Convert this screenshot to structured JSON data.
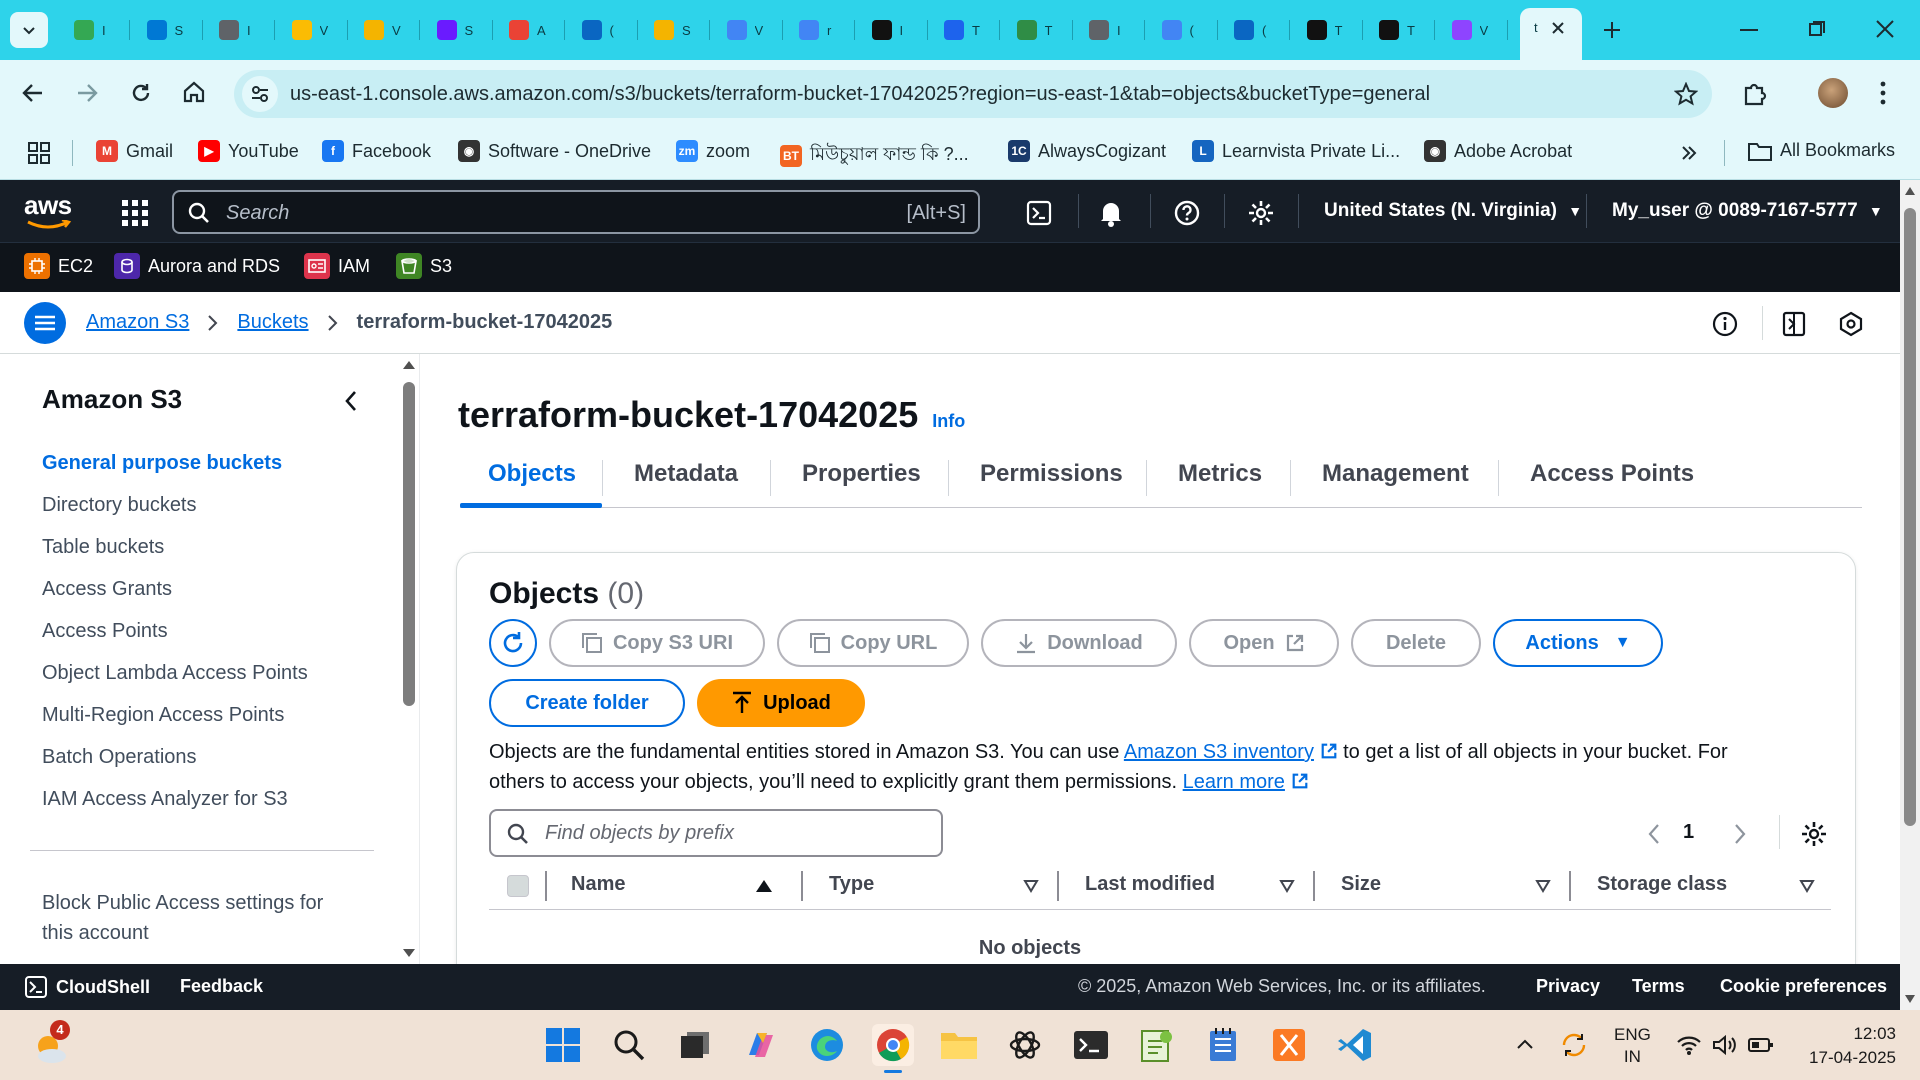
{
  "browser": {
    "tabs": [
      {
        "icon": "drive-icon",
        "title": "I",
        "color": "#34a853"
      },
      {
        "icon": "azure-icon",
        "title": "S",
        "color": "#0078d4"
      },
      {
        "icon": "globe-icon",
        "title": "I",
        "color": "#5f6368"
      },
      {
        "icon": "google-drive-icon",
        "title": "V",
        "color": "#fbbc04"
      },
      {
        "icon": "notes-icon",
        "title": "V",
        "color": "#f4b400"
      },
      {
        "icon": "arrow-icon",
        "title": "S",
        "color": "#6a1bff"
      },
      {
        "icon": "gmail-icon",
        "title": "A",
        "color": "#ea4335"
      },
      {
        "icon": "linkedin-icon",
        "title": "(",
        "color": "#0a66c2"
      },
      {
        "icon": "notes-icon",
        "title": "S",
        "color": "#f4b400"
      },
      {
        "icon": "globe-icon",
        "title": "V",
        "color": "#4285f4"
      },
      {
        "icon": "google-icon",
        "title": "r",
        "color": "#4285f4"
      },
      {
        "icon": "github-icon",
        "title": "I",
        "color": "#111"
      },
      {
        "icon": "docker-icon",
        "title": "T",
        "color": "#1d63ed"
      },
      {
        "icon": "gfg-icon",
        "title": "T",
        "color": "#2f8d46"
      },
      {
        "icon": "globe-icon",
        "title": "I",
        "color": "#5f6368"
      },
      {
        "icon": "docs-icon",
        "title": "(",
        "color": "#4285f4"
      },
      {
        "icon": "linkedin-icon",
        "title": "(",
        "color": "#0a66c2"
      },
      {
        "icon": "github-icon",
        "title": "T",
        "color": "#111"
      },
      {
        "icon": "github-icon",
        "title": "T",
        "color": "#111"
      },
      {
        "icon": "extension-icon",
        "title": "V",
        "color": "#8e44ff"
      }
    ],
    "active_tab_title": "t",
    "url": "us-east-1.console.aws.amazon.com/s3/buckets/terraform-bucket-17042025?region=us-east-1&tab=objects&bucketType=general",
    "bookmarks": [
      {
        "label": "Gmail",
        "icon": "gmail-icon",
        "color": "#ea4335",
        "glyph": "M"
      },
      {
        "label": "YouTube",
        "icon": "youtube-icon",
        "color": "#ff0000",
        "glyph": "▶"
      },
      {
        "label": "Facebook",
        "icon": "facebook-icon",
        "color": "#1877f2",
        "glyph": "f"
      },
      {
        "label": "Software - OneDrive",
        "icon": "globe-icon",
        "color": "#333",
        "glyph": "◉"
      },
      {
        "label": "zoom",
        "icon": "zoom-icon",
        "color": "#2d8cff",
        "glyph": "zm"
      },
      {
        "label": "মিউচুয়াল ফান্ড কি ?...",
        "icon": "bt-icon",
        "color": "#f26522",
        "glyph": "BT"
      },
      {
        "label": "AlwaysCogizant",
        "icon": "ic-icon",
        "color": "#1a3a6b",
        "glyph": "1C"
      },
      {
        "label": "Learnvista Private Li...",
        "icon": "learnvista-icon",
        "color": "#1565c0",
        "glyph": "L"
      },
      {
        "label": "Adobe Acrobat",
        "icon": "globe-icon",
        "color": "#333",
        "glyph": "◉"
      }
    ],
    "all_bookmarks": "All Bookmarks"
  },
  "aws": {
    "logo": "aws",
    "search_placeholder": "Search",
    "search_shortcut": "[Alt+S]",
    "region": "United States (N. Virginia)",
    "account": "My_user @ 0089-7167-5777",
    "favorites": [
      {
        "label": "EC2",
        "icon": "ec2-icon",
        "color": "#ed7100"
      },
      {
        "label": "Aurora and RDS",
        "icon": "rds-icon",
        "color": "#4d27aa"
      },
      {
        "label": "IAM",
        "icon": "iam-icon",
        "color": "#dd344c"
      },
      {
        "label": "S3",
        "icon": "s3-icon",
        "color": "#3f8624"
      }
    ]
  },
  "breadcrumb": {
    "items": [
      "Amazon S3",
      "Buckets"
    ],
    "current": "terraform-bucket-17042025"
  },
  "sidebar": {
    "title": "Amazon S3",
    "items": [
      "General purpose buckets",
      "Directory buckets",
      "Table buckets",
      "Access Grants",
      "Access Points",
      "Object Lambda Access Points",
      "Multi-Region Access Points",
      "Batch Operations",
      "IAM Access Analyzer for S3"
    ],
    "footer_item_line1": "Block Public Access settings for",
    "footer_item_line2": "this account"
  },
  "main": {
    "title": "terraform-bucket-17042025",
    "info": "Info",
    "tabs": [
      "Objects",
      "Metadata",
      "Properties",
      "Permissions",
      "Metrics",
      "Management",
      "Access Points"
    ],
    "objects": {
      "heading": "Objects",
      "count": "(0)",
      "buttons": {
        "copy_s3_uri": "Copy S3 URI",
        "copy_url": "Copy URL",
        "download": "Download",
        "open": "Open",
        "delete": "Delete",
        "actions": "Actions",
        "create_folder": "Create folder",
        "upload": "Upload"
      },
      "desc_part1": "Objects are the fundamental entities stored in Amazon S3. You can use ",
      "desc_link1": "Amazon S3 inventory",
      "desc_part2": " to get a list of all objects in your bucket. For",
      "desc_line2": "others to access your objects, you’ll need to explicitly grant them permissions. ",
      "desc_link2": "Learn more",
      "filter_placeholder": "Find objects by prefix",
      "page": "1",
      "columns": [
        "Name",
        "Type",
        "Last modified",
        "Size",
        "Storage class"
      ],
      "empty": "No objects"
    }
  },
  "footer": {
    "cloudshell": "CloudShell",
    "feedback": "Feedback",
    "copyright": "© 2025, Amazon Web Services, Inc. or its affiliates.",
    "privacy": "Privacy",
    "terms": "Terms",
    "cookies": "Cookie preferences"
  },
  "taskbar": {
    "weather_badge": "4",
    "lang_line1": "ENG",
    "lang_line2": "IN",
    "time": "12:03",
    "date": "17-04-2025"
  }
}
